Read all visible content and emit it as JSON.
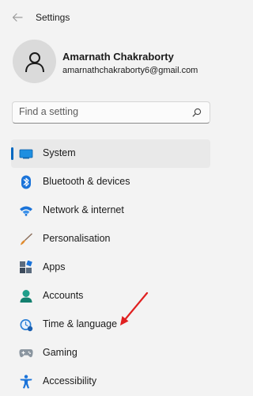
{
  "window": {
    "title": "Settings"
  },
  "profile": {
    "name": "Amarnath Chakraborty",
    "email": "amarnathchakraborty6@gmail.com"
  },
  "search": {
    "placeholder": "Find a setting"
  },
  "nav": {
    "selected": "System",
    "items": [
      {
        "label": "System",
        "icon": "system-icon"
      },
      {
        "label": "Bluetooth & devices",
        "icon": "bluetooth-icon"
      },
      {
        "label": "Network & internet",
        "icon": "wifi-icon"
      },
      {
        "label": "Personalisation",
        "icon": "brush-icon"
      },
      {
        "label": "Apps",
        "icon": "apps-icon"
      },
      {
        "label": "Accounts",
        "icon": "accounts-icon"
      },
      {
        "label": "Time & language",
        "icon": "time-language-icon"
      },
      {
        "label": "Gaming",
        "icon": "gaming-icon"
      },
      {
        "label": "Accessibility",
        "icon": "accessibility-icon"
      }
    ]
  },
  "colors": {
    "accent": "#0067c0",
    "annotation_arrow": "#e02020"
  }
}
